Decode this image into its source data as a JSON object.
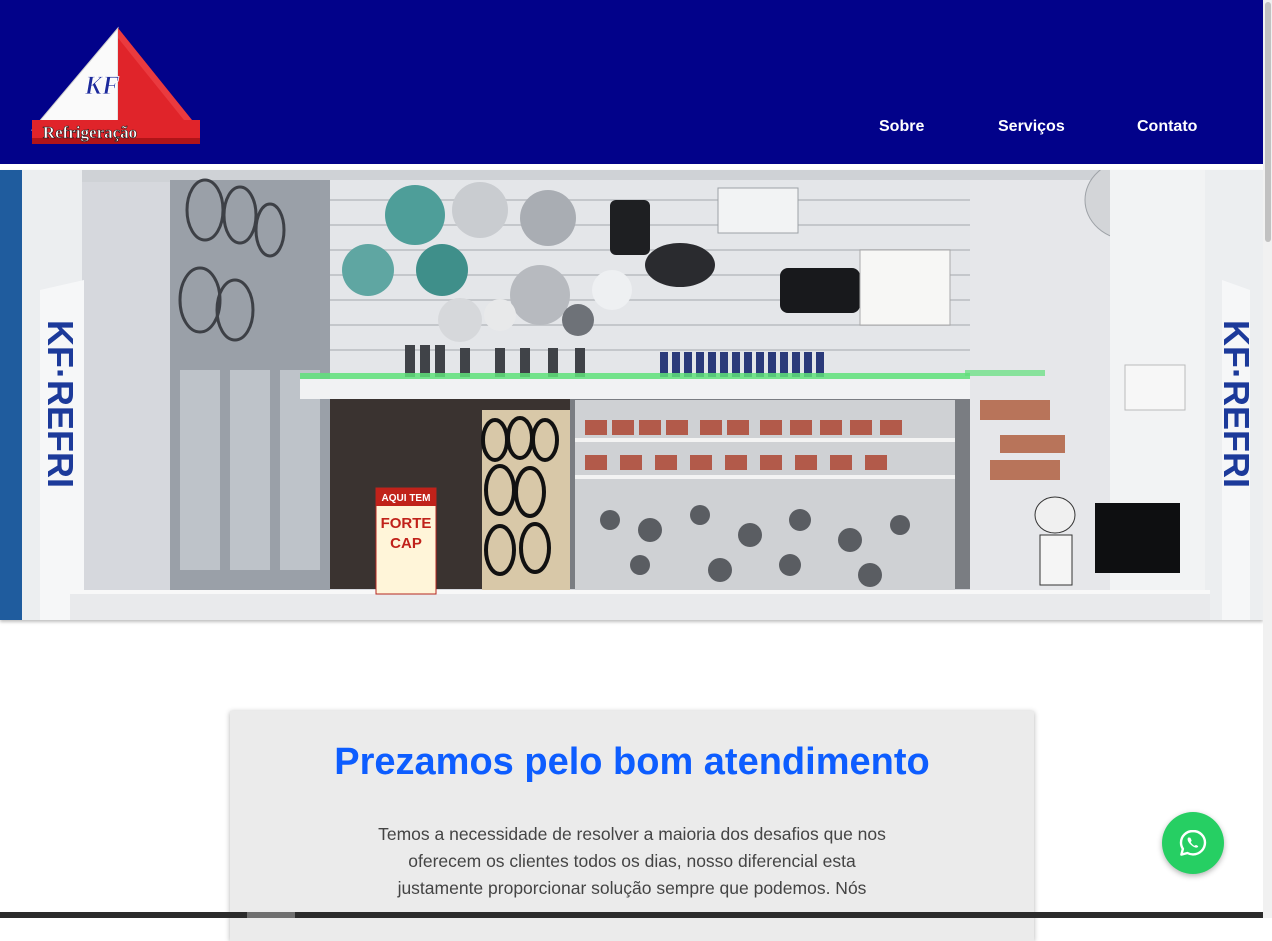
{
  "colors": {
    "header_bg": "#02028a",
    "title_blue": "#0d5dff",
    "whatsapp_green": "#26cf63",
    "logo_red": "#e0242a",
    "logo_blue": "#1c2a9c"
  },
  "logo": {
    "mark": "KF",
    "wordmark": "Refrigeração"
  },
  "nav": {
    "items": [
      {
        "label": "Sobre"
      },
      {
        "label": "Serviços"
      },
      {
        "label": "Contato"
      }
    ]
  },
  "hero": {
    "side_sign": "KF·REFRI",
    "box_label_1": "AQUI TEM",
    "box_label_2": "FORTE",
    "box_label_3": "CAP"
  },
  "card": {
    "title": "Prezamos pelo bom atendimento",
    "text_lines": [
      "Temos a necessidade de resolver a maioria dos desafios que nos",
      "oferecem os clientes todos os dias, nosso diferencial esta",
      "justamente proporcionar solução sempre que podemos. Nós"
    ]
  },
  "whatsapp": {
    "icon": "whatsapp-icon"
  }
}
